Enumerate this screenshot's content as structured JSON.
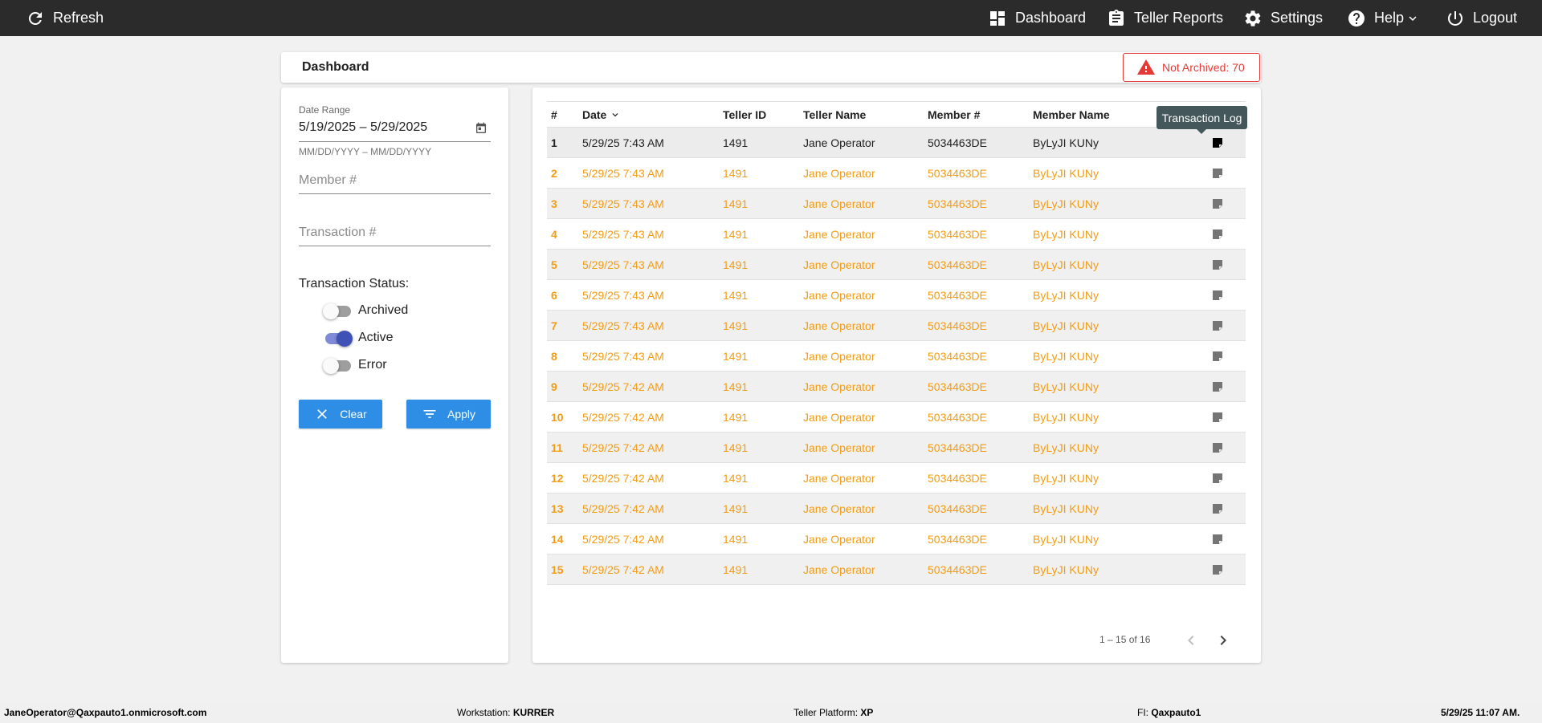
{
  "topbar": {
    "refresh": "Refresh",
    "dashboard": "Dashboard",
    "teller_reports": "Teller Reports",
    "settings": "Settings",
    "help": "Help",
    "logout": "Logout"
  },
  "header": {
    "title": "Dashboard",
    "not_archived": "Not Archived: 70"
  },
  "filters": {
    "date_label": "Date Range",
    "date_value": "5/19/2025 – 5/29/2025",
    "date_hint": "MM/DD/YYYY – MM/DD/YYYY",
    "member_placeholder": "Member #",
    "transaction_placeholder": "Transaction #",
    "status_label": "Transaction Status:",
    "archived": "Archived",
    "active": "Active",
    "error": "Error",
    "clear": "Clear",
    "apply": "Apply"
  },
  "table": {
    "columns": [
      "#",
      "Date",
      "Teller ID",
      "Teller Name",
      "Member #",
      "Member Name"
    ],
    "tooltip": "Transaction Log",
    "rows": [
      {
        "n": "1",
        "date": "5/29/25 7:43 AM",
        "teller_id": "1491",
        "teller_name": "Jane Operator",
        "member": "5034463DE",
        "member_name": "ByLyJI KUNy"
      },
      {
        "n": "2",
        "date": "5/29/25 7:43 AM",
        "teller_id": "1491",
        "teller_name": "Jane Operator",
        "member": "5034463DE",
        "member_name": "ByLyJI KUNy"
      },
      {
        "n": "3",
        "date": "5/29/25 7:43 AM",
        "teller_id": "1491",
        "teller_name": "Jane Operator",
        "member": "5034463DE",
        "member_name": "ByLyJI KUNy"
      },
      {
        "n": "4",
        "date": "5/29/25 7:43 AM",
        "teller_id": "1491",
        "teller_name": "Jane Operator",
        "member": "5034463DE",
        "member_name": "ByLyJI KUNy"
      },
      {
        "n": "5",
        "date": "5/29/25 7:43 AM",
        "teller_id": "1491",
        "teller_name": "Jane Operator",
        "member": "5034463DE",
        "member_name": "ByLyJI KUNy"
      },
      {
        "n": "6",
        "date": "5/29/25 7:43 AM",
        "teller_id": "1491",
        "teller_name": "Jane Operator",
        "member": "5034463DE",
        "member_name": "ByLyJI KUNy"
      },
      {
        "n": "7",
        "date": "5/29/25 7:43 AM",
        "teller_id": "1491",
        "teller_name": "Jane Operator",
        "member": "5034463DE",
        "member_name": "ByLyJI KUNy"
      },
      {
        "n": "8",
        "date": "5/29/25 7:43 AM",
        "teller_id": "1491",
        "teller_name": "Jane Operator",
        "member": "5034463DE",
        "member_name": "ByLyJI KUNy"
      },
      {
        "n": "9",
        "date": "5/29/25 7:42 AM",
        "teller_id": "1491",
        "teller_name": "Jane Operator",
        "member": "5034463DE",
        "member_name": "ByLyJI KUNy"
      },
      {
        "n": "10",
        "date": "5/29/25 7:42 AM",
        "teller_id": "1491",
        "teller_name": "Jane Operator",
        "member": "5034463DE",
        "member_name": "ByLyJI KUNy"
      },
      {
        "n": "11",
        "date": "5/29/25 7:42 AM",
        "teller_id": "1491",
        "teller_name": "Jane Operator",
        "member": "5034463DE",
        "member_name": "ByLyJI KUNy"
      },
      {
        "n": "12",
        "date": "5/29/25 7:42 AM",
        "teller_id": "1491",
        "teller_name": "Jane Operator",
        "member": "5034463DE",
        "member_name": "ByLyJI KUNy"
      },
      {
        "n": "13",
        "date": "5/29/25 7:42 AM",
        "teller_id": "1491",
        "teller_name": "Jane Operator",
        "member": "5034463DE",
        "member_name": "ByLyJI KUNy"
      },
      {
        "n": "14",
        "date": "5/29/25 7:42 AM",
        "teller_id": "1491",
        "teller_name": "Jane Operator",
        "member": "5034463DE",
        "member_name": "ByLyJI KUNy"
      },
      {
        "n": "15",
        "date": "5/29/25 7:42 AM",
        "teller_id": "1491",
        "teller_name": "Jane Operator",
        "member": "5034463DE",
        "member_name": "ByLyJI KUNy"
      }
    ],
    "paging": "1 – 15 of 16"
  },
  "footer": {
    "user": "JaneOperator@Qaxpauto1.onmicrosoft.com",
    "workstation_label": "Workstation:",
    "workstation": "KURRER",
    "platform_label": "Teller Platform:",
    "platform": "XP",
    "fi_label": "FI:",
    "fi": "Qaxpauto1",
    "datetime": "5/29/25 11:07 AM."
  },
  "colors": {
    "topbar": "#2b2b2b",
    "accent_orange": "#f39c12",
    "button_blue": "#2e8ee6",
    "alert_red": "#e53935",
    "toggle_on": "#3f51b5"
  }
}
